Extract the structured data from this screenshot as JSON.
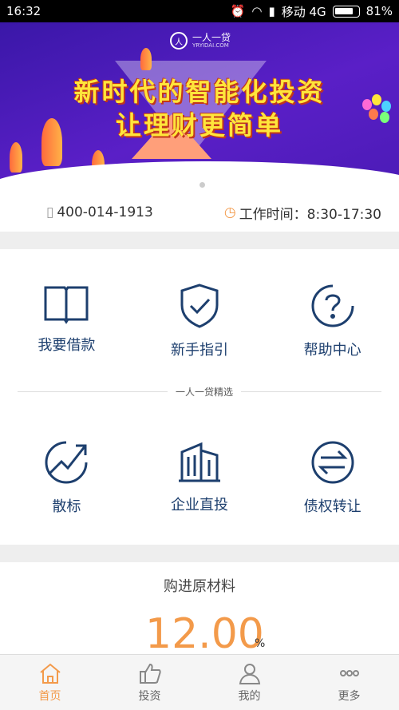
{
  "status_bar": {
    "time": "16:32",
    "carrier": "移动 4G",
    "battery": "81%"
  },
  "banner": {
    "logo_text": "一人一贷",
    "logo_sub": "YRYIDAI.COM",
    "slogan_line1": "新时代的智能化投资",
    "slogan_line2": "让理财更简单",
    "pagination": [
      true,
      false
    ]
  },
  "info": {
    "phone": "400-014-1913",
    "hours": "工作时间：8:30-17:30"
  },
  "quick_links": [
    {
      "label": "我要借款",
      "icon": "book-icon"
    },
    {
      "label": "新手指引",
      "icon": "shield-check-icon"
    },
    {
      "label": "帮助中心",
      "icon": "question-icon"
    }
  ],
  "section_title": "一人一贷精选",
  "products": [
    {
      "label": "散标",
      "icon": "trend-up-icon"
    },
    {
      "label": "企业直投",
      "icon": "building-icon"
    },
    {
      "label": "债权转让",
      "icon": "transfer-icon"
    }
  ],
  "card": {
    "title": "购进原材料",
    "rate": "12.00",
    "unit": "%"
  },
  "tabbar": [
    {
      "label": "首页",
      "icon": "home-icon",
      "active": true
    },
    {
      "label": "投资",
      "icon": "thumb-up-icon",
      "active": false
    },
    {
      "label": "我的",
      "icon": "user-icon",
      "active": false
    },
    {
      "label": "更多",
      "icon": "more-icon",
      "active": false
    }
  ],
  "colors": {
    "accent": "#f39a4a",
    "icon_blue": "#1d3f6e",
    "banner_bg": "#4b1bb6"
  }
}
